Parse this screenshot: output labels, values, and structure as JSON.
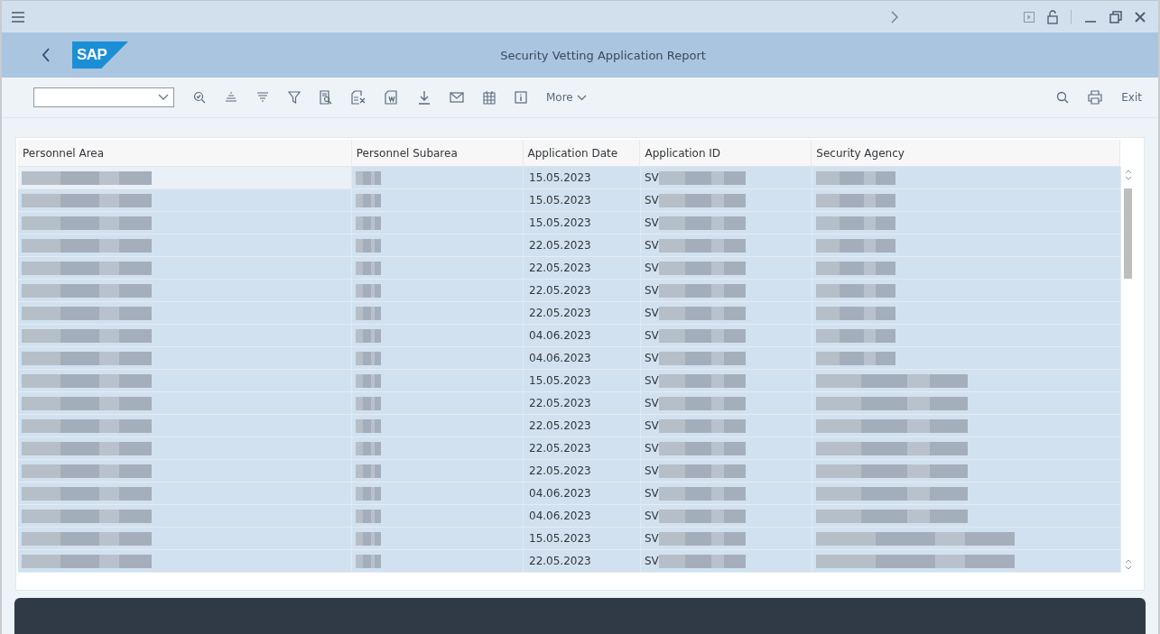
{
  "window": {
    "title": "Security Vetting Application Report",
    "logo": "SAP"
  },
  "toolbar": {
    "more": "More",
    "exit": "Exit"
  },
  "table": {
    "columns": [
      "Personnel Area",
      "Personnel Subarea",
      "Application Date",
      "Application ID",
      "Security Agency"
    ],
    "rows": [
      {
        "date": "15.05.2023",
        "id": "SV",
        "kind": "short",
        "selected": true,
        "current": true
      },
      {
        "date": "15.05.2023",
        "id": "SV",
        "kind": "short",
        "selected": true,
        "current": false
      },
      {
        "date": "15.05.2023",
        "id": "SV",
        "kind": "short",
        "selected": true,
        "current": false
      },
      {
        "date": "22.05.2023",
        "id": "SV",
        "kind": "short",
        "selected": true,
        "current": false
      },
      {
        "date": "22.05.2023",
        "id": "SV",
        "kind": "short",
        "selected": true,
        "current": false
      },
      {
        "date": "22.05.2023",
        "id": "SV",
        "kind": "short",
        "selected": true,
        "current": false
      },
      {
        "date": "22.05.2023",
        "id": "SV",
        "kind": "short",
        "selected": true,
        "current": false
      },
      {
        "date": "04.06.2023",
        "id": "SV",
        "kind": "short",
        "selected": true,
        "current": false
      },
      {
        "date": "04.06.2023",
        "id": "SV",
        "kind": "short",
        "selected": true,
        "current": false
      },
      {
        "date": "15.05.2023",
        "id": "SV",
        "kind": "long",
        "selected": true,
        "current": false
      },
      {
        "date": "22.05.2023",
        "id": "SV",
        "kind": "long",
        "selected": true,
        "current": false
      },
      {
        "date": "22.05.2023",
        "id": "SV",
        "kind": "long",
        "selected": true,
        "current": false
      },
      {
        "date": "22.05.2023",
        "id": "SV",
        "kind": "long",
        "selected": true,
        "current": false
      },
      {
        "date": "22.05.2023",
        "id": "SV",
        "kind": "long",
        "selected": true,
        "current": false
      },
      {
        "date": "04.06.2023",
        "id": "SV",
        "kind": "long",
        "selected": true,
        "current": false
      },
      {
        "date": "04.06.2023",
        "id": "SV",
        "kind": "long",
        "selected": true,
        "current": false
      },
      {
        "date": "15.05.2023",
        "id": "SV",
        "kind": "longer",
        "selected": true,
        "current": false
      },
      {
        "date": "22.05.2023",
        "id": "SV",
        "kind": "longer",
        "selected": true,
        "current": false
      }
    ]
  }
}
